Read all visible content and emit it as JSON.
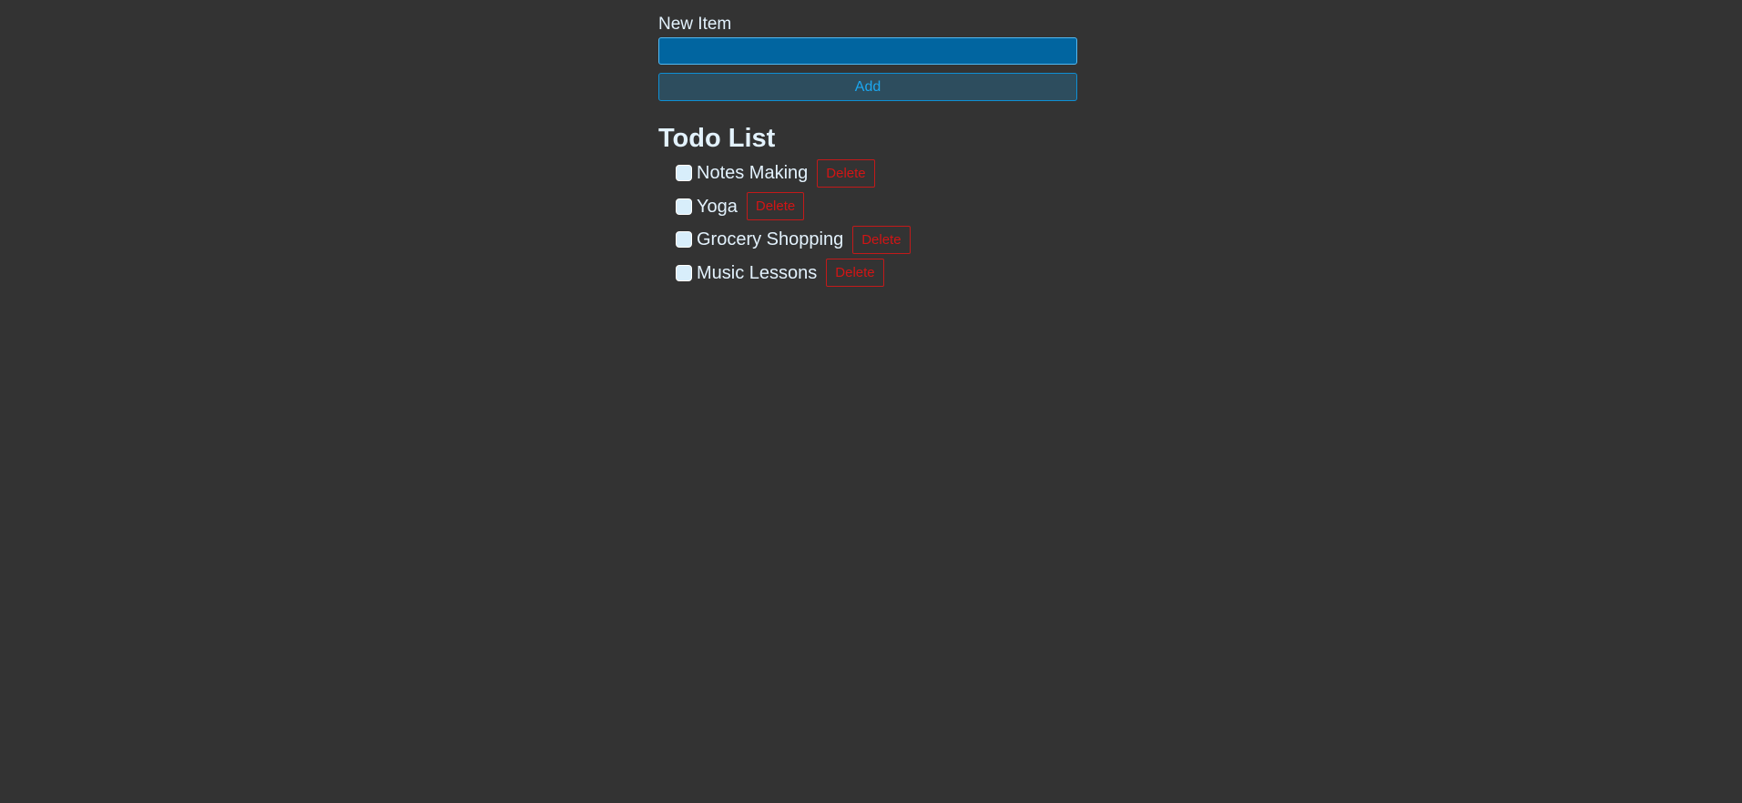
{
  "form": {
    "label": "New Item",
    "input_value": "",
    "input_placeholder": "",
    "add_label": "Add"
  },
  "list": {
    "title": "Todo List",
    "items": [
      {
        "text": "Notes Making",
        "checked": false,
        "delete_label": "Delete"
      },
      {
        "text": "Yoga",
        "checked": false,
        "delete_label": "Delete"
      },
      {
        "text": "Grocery Shopping",
        "checked": false,
        "delete_label": "Delete"
      },
      {
        "text": "Music Lessons",
        "checked": false,
        "delete_label": "Delete"
      }
    ]
  },
  "colors": {
    "background": "#333333",
    "text": "#e3f2fd",
    "input_bg": "#0165a0",
    "accent": "#1ba7f0",
    "danger": "#d21515"
  }
}
